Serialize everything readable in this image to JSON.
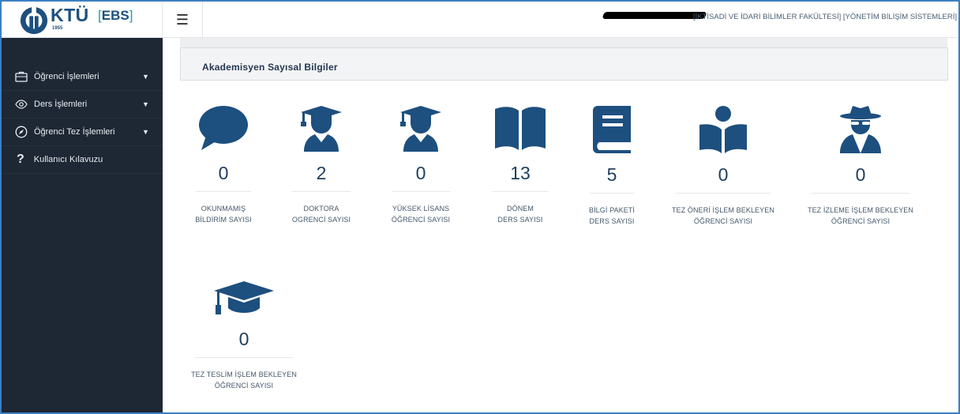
{
  "brand": {
    "logo": "KTÜ",
    "logo_year": "1955",
    "system": "EBS"
  },
  "topbar": {
    "menu_icon": "hamburger-icon",
    "faculty": "[İKTİSADİ VE İDARİ BİLİMLER FAKÜLTESİ]",
    "department": "[YÖNETİM BİLİŞİM SİSTEMLERİ]"
  },
  "sidebar": {
    "items": [
      {
        "label": "Öğrenci İşlemleri",
        "icon": "briefcase-icon",
        "expandable": true
      },
      {
        "label": "Ders İşlemleri",
        "icon": "eye-icon",
        "expandable": true
      },
      {
        "label": "Öğrenci Tez İşlemleri",
        "icon": "compass-icon",
        "expandable": true
      },
      {
        "label": "Kullanıcı Kılavuzu",
        "icon": "question-icon",
        "expandable": false
      }
    ]
  },
  "panel": {
    "title": "Akademisyen Sayısal Bilgiler"
  },
  "stats": [
    {
      "value": "0",
      "line1": "OKUNMAMIŞ",
      "line2": "BİLDİRİM SAYISI",
      "icon": "speech-bubble-icon"
    },
    {
      "value": "2",
      "line1": "DOKTORA",
      "line2": "OGRENCİ SAYISI",
      "icon": "graduate-student-icon"
    },
    {
      "value": "0",
      "line1": "YÜKSEK LİSANS",
      "line2": "ÖĞRENCİ SAYISI",
      "icon": "graduate-student-icon"
    },
    {
      "value": "13",
      "line1": "DÖNEM",
      "line2": "DERS SAYISI",
      "icon": "open-book-icon"
    },
    {
      "value": "5",
      "line1": "BİLGİ PAKETİ",
      "line2": "DERS SAYISI",
      "icon": "closed-book-icon"
    },
    {
      "value": "0",
      "line1": "TEZ ÖNERİ İŞLEM BEKLEYEN",
      "line2": "ÖĞRENCİ SAYISI",
      "icon": "reader-icon"
    },
    {
      "value": "0",
      "line1": "TEZ İZLEME İŞLEM BEKLEYEN",
      "line2": "ÖĞRENCİ SAYISI",
      "icon": "spy-icon"
    },
    {
      "value": "0",
      "line1": "TEZ TESLİM İŞLEM BEKLEYEN",
      "line2": "ÖĞRENCİ SAYISI",
      "icon": "graduation-cap-icon"
    }
  ],
  "colors": {
    "sidebar": "#1e2734",
    "icon": "#1d4f7f",
    "frame": "#3d7fc1"
  }
}
